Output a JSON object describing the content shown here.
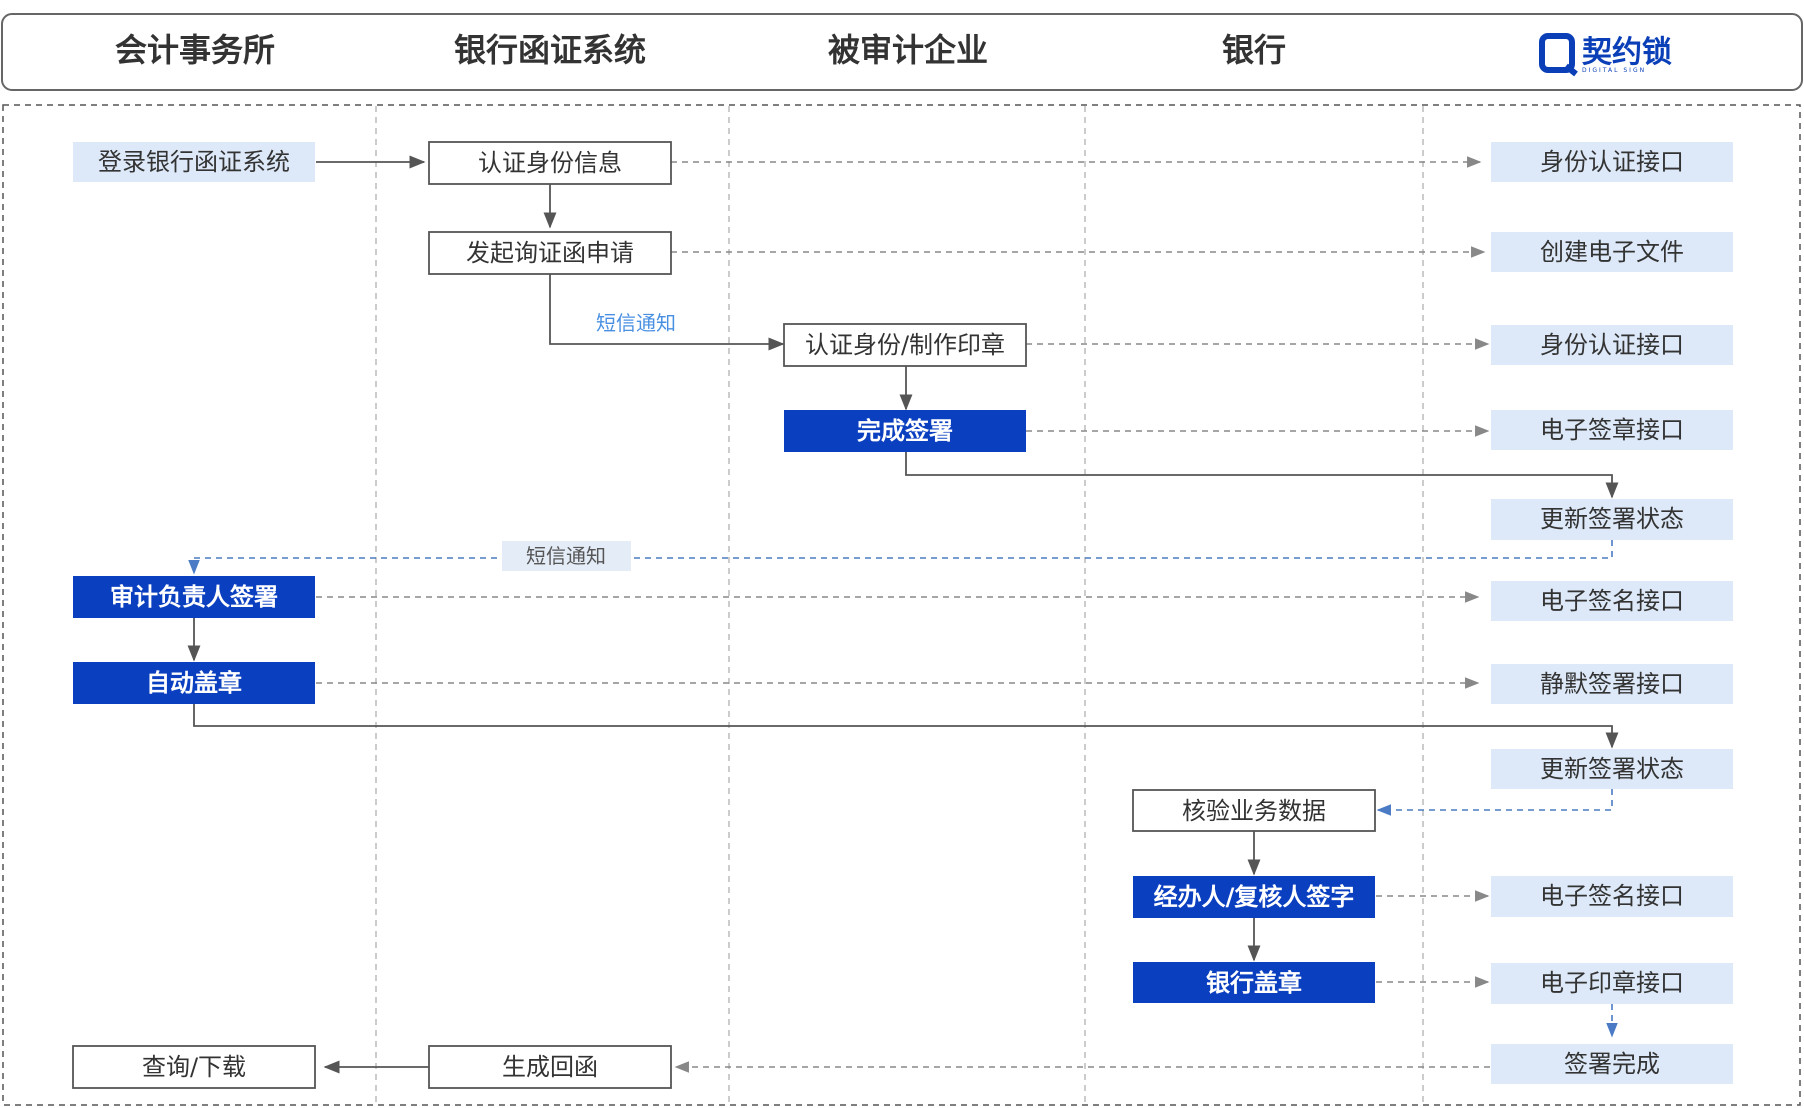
{
  "header": {
    "lanes": [
      "会计事务所",
      "银行函证系统",
      "被审计企业",
      "银行"
    ],
    "logo": {
      "text": "契约锁",
      "sub": "DIGITAL SIGN"
    }
  },
  "colors": {
    "primary": "#0a3fc0",
    "api_bg": "#dde9f8",
    "line": "#555555",
    "dash": "#888888",
    "blue_dash": "#4a7bc4",
    "note_blue": "#4a90e2"
  },
  "nodes": {
    "n1": "登录银行函证系统",
    "n2": "认证身份信息",
    "n3": "发起询证函申请",
    "n4": "认证身份/制作印章",
    "n5": "完成签署",
    "n6": "审计负责人签署",
    "n7": "自动盖章",
    "n8": "核验业务数据",
    "n9": "经办人/复核人签字",
    "n10": "银行盖章",
    "n11": "生成回函",
    "n12": "查询/下载"
  },
  "apis": {
    "a1": "身份认证接口",
    "a2": "创建电子文件",
    "a3": "身份认证接口",
    "a4": "电子签章接口",
    "a5": "更新签署状态",
    "a6": "电子签名接口",
    "a7": "静默签署接口",
    "a8": "更新签署状态",
    "a9": "电子签名接口",
    "a10": "电子印章接口",
    "a11": "签署完成"
  },
  "notes": {
    "sms1": "短信通知",
    "sms2": "短信通知"
  }
}
